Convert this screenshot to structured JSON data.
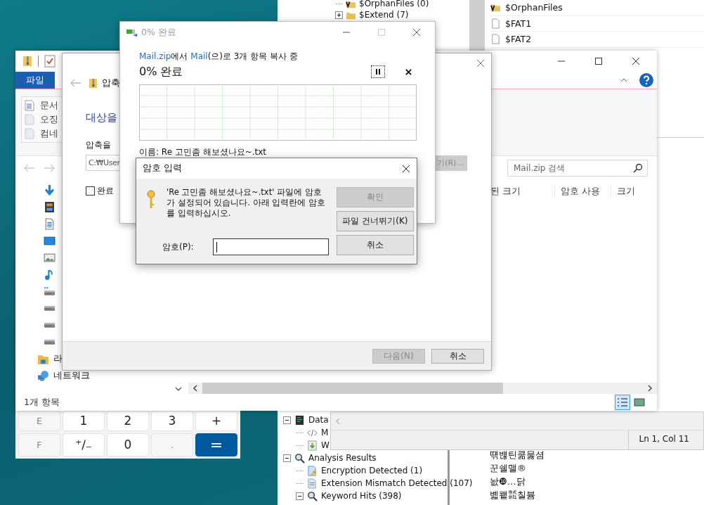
{
  "autopsy": {
    "tree_top": [
      {
        "label": "$OrphanFiles (0)",
        "kind": "folder-v"
      },
      {
        "label": "$Extend (7)",
        "kind": "folder",
        "expanded": false
      }
    ],
    "file_list": [
      {
        "label": "$OrphanFiles",
        "kind": "folder-v"
      },
      {
        "label": "$FAT1",
        "kind": "file"
      },
      {
        "label": "$FAT2",
        "kind": "file"
      }
    ],
    "tree_bottom": [
      {
        "label": "Data",
        "kind": "data",
        "expanded": true,
        "children": [
          {
            "label": "M",
            "kind": "code"
          },
          {
            "label": "W",
            "kind": "download-page"
          }
        ]
      },
      {
        "label": "Analysis Results",
        "kind": "magnifier",
        "expanded": true,
        "children": [
          {
            "label": "Encryption Detected (1)",
            "kind": "key-doc"
          },
          {
            "label": "Extension Mismatch Detected (107)",
            "kind": "doc"
          },
          {
            "label": "Keyword Hits (398)",
            "kind": "magnifier",
            "expanded": true
          }
        ]
      }
    ],
    "text_lines": [
      "떆뱮틴쿪뭃셤",
      "꾼쉘맬®",
      "놦❿…닭",
      "볣쾥㍿칠븀"
    ]
  },
  "editor": {
    "status": "Ln 1, Col 11"
  },
  "calculator": {
    "keys": [
      {
        "label": "E",
        "kind": "function"
      },
      {
        "label": "1",
        "kind": "digit"
      },
      {
        "label": "2",
        "kind": "digit"
      },
      {
        "label": "3",
        "kind": "digit"
      },
      {
        "label": "+",
        "kind": "operator"
      },
      {
        "label": "F",
        "kind": "function"
      },
      {
        "label": "⁺∕₋",
        "kind": "digit"
      },
      {
        "label": "0",
        "kind": "digit"
      },
      {
        "label": ".",
        "kind": "function"
      },
      {
        "label": "=",
        "kind": "equals"
      }
    ]
  },
  "explorer": {
    "tab": {
      "label": "파일",
      "selected": true
    },
    "ribbon_items": [
      {
        "label": "문서",
        "kind": "document"
      },
      {
        "label": "오징",
        "kind": "blank"
      },
      {
        "label": "컴네",
        "kind": "blank"
      }
    ],
    "this_pc_items": [
      {
        "kind": "download"
      },
      {
        "kind": "video"
      },
      {
        "kind": "document"
      },
      {
        "kind": "desktop"
      },
      {
        "kind": "picture"
      },
      {
        "kind": "music"
      },
      {
        "kind": "system-drive"
      },
      {
        "kind": "drive"
      },
      {
        "kind": "drive"
      },
      {
        "kind": "drive"
      }
    ],
    "nav_items": [
      {
        "label": "라",
        "kind": "library"
      },
      {
        "label": "네트워크",
        "kind": "network"
      }
    ],
    "search_placeholder": "Mail.zip 검색",
    "columns": [
      "된 크기",
      "암호 사용",
      "크기"
    ],
    "status": "1개 항목",
    "view_buttons": [
      {
        "kind": "details",
        "selected": true
      },
      {
        "kind": "thumbnails",
        "selected": false
      }
    ]
  },
  "wizard": {
    "title": "압축",
    "heading": "대상을",
    "path_label": "압축을",
    "path_value": "C:₩User",
    "browse_button": {
      "label": "기(R)...",
      "disabled": true
    },
    "checkbox": {
      "label": "완료",
      "checked": false
    },
    "buttons": [
      {
        "label": "다음(N)",
        "disabled": true
      },
      {
        "label": "취소",
        "disabled": false
      }
    ]
  },
  "copy_dialog": {
    "title": "0% 완료",
    "summary": [
      {
        "text": "Mail.zip",
        "kind": "link"
      },
      {
        "text": "에서 ",
        "kind": "plain"
      },
      {
        "text": "Mail",
        "kind": "link"
      },
      {
        "text": "(으)로 3개 항목 복사 중",
        "kind": "plain"
      }
    ],
    "progress_text": "0% 완료",
    "file_name": "이름: Re 고민좀 해보셨나요~.txt"
  },
  "password_dialog": {
    "title": "암호 입력",
    "message": "'Re 고민좀 해보셨나요~.txt' 파일에 암호가 설정되어 있습니다. 아래 입력란에 암호를 입력하십시오.",
    "buttons": [
      {
        "label": "확인",
        "disabled": true
      },
      {
        "label": "파일 건너뛰기(K)",
        "disabled": false
      },
      {
        "label": "취소",
        "disabled": false
      }
    ],
    "password_label": "암호(P):",
    "focused": true
  }
}
